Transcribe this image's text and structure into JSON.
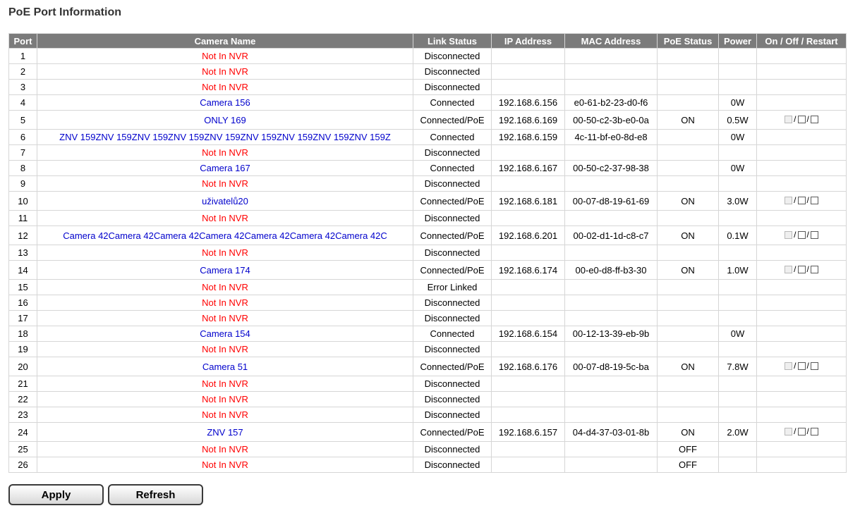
{
  "page": {
    "title": "PoE Port Information"
  },
  "table": {
    "headers": {
      "port": "Port",
      "camera_name": "Camera Name",
      "link_status": "Link Status",
      "ip": "IP Address",
      "mac": "MAC Address",
      "poe_status": "PoE Status",
      "power": "Power",
      "control": "On / Off / Restart"
    },
    "control_separator": "/",
    "rows": [
      {
        "port": "1",
        "camera": "Not In NVR",
        "cam_color": "red",
        "link": "Disconnected",
        "ip": "",
        "mac": "",
        "poe": "",
        "power": "",
        "control": false
      },
      {
        "port": "2",
        "camera": "Not In NVR",
        "cam_color": "red",
        "link": "Disconnected",
        "ip": "",
        "mac": "",
        "poe": "",
        "power": "",
        "control": false
      },
      {
        "port": "3",
        "camera": "Not In NVR",
        "cam_color": "red",
        "link": "Disconnected",
        "ip": "",
        "mac": "",
        "poe": "",
        "power": "",
        "control": false
      },
      {
        "port": "4",
        "camera": "Camera 156",
        "cam_color": "blue",
        "link": "Connected",
        "ip": "192.168.6.156",
        "mac": "e0-61-b2-23-d0-f6",
        "poe": "",
        "power": "0W",
        "control": false
      },
      {
        "port": "5",
        "camera": "ONLY 169",
        "cam_color": "blue",
        "link": "Connected/PoE",
        "ip": "192.168.6.169",
        "mac": "00-50-c2-3b-e0-0a",
        "poe": "ON",
        "power": "0.5W",
        "control": true
      },
      {
        "port": "6",
        "camera": "ZNV 159ZNV 159ZNV 159ZNV 159ZNV 159ZNV 159ZNV 159ZNV 159ZNV 159Z",
        "cam_color": "blue",
        "link": "Connected",
        "ip": "192.168.6.159",
        "mac": "4c-11-bf-e0-8d-e8",
        "poe": "",
        "power": "0W",
        "control": false
      },
      {
        "port": "7",
        "camera": "Not In NVR",
        "cam_color": "red",
        "link": "Disconnected",
        "ip": "",
        "mac": "",
        "poe": "",
        "power": "",
        "control": false
      },
      {
        "port": "8",
        "camera": "Camera 167",
        "cam_color": "blue",
        "link": "Connected",
        "ip": "192.168.6.167",
        "mac": "00-50-c2-37-98-38",
        "poe": "",
        "power": "0W",
        "control": false
      },
      {
        "port": "9",
        "camera": "Not In NVR",
        "cam_color": "red",
        "link": "Disconnected",
        "ip": "",
        "mac": "",
        "poe": "",
        "power": "",
        "control": false
      },
      {
        "port": "10",
        "camera": "uživatelů20",
        "cam_color": "blue",
        "link": "Connected/PoE",
        "ip": "192.168.6.181",
        "mac": "00-07-d8-19-61-69",
        "poe": "ON",
        "power": "3.0W",
        "control": true
      },
      {
        "port": "11",
        "camera": "Not In NVR",
        "cam_color": "red",
        "link": "Disconnected",
        "ip": "",
        "mac": "",
        "poe": "",
        "power": "",
        "control": false
      },
      {
        "port": "12",
        "camera": "Camera 42Camera 42Camera 42Camera 42Camera 42Camera 42Camera 42C",
        "cam_color": "blue",
        "link": "Connected/PoE",
        "ip": "192.168.6.201",
        "mac": "00-02-d1-1d-c8-c7",
        "poe": "ON",
        "power": "0.1W",
        "control": true
      },
      {
        "port": "13",
        "camera": "Not In NVR",
        "cam_color": "red",
        "link": "Disconnected",
        "ip": "",
        "mac": "",
        "poe": "",
        "power": "",
        "control": false
      },
      {
        "port": "14",
        "camera": "Camera 174",
        "cam_color": "blue",
        "link": "Connected/PoE",
        "ip": "192.168.6.174",
        "mac": "00-e0-d8-ff-b3-30",
        "poe": "ON",
        "power": "1.0W",
        "control": true
      },
      {
        "port": "15",
        "camera": "Not In NVR",
        "cam_color": "red",
        "link": "Error Linked",
        "ip": "",
        "mac": "",
        "poe": "",
        "power": "",
        "control": false
      },
      {
        "port": "16",
        "camera": "Not In NVR",
        "cam_color": "red",
        "link": "Disconnected",
        "ip": "",
        "mac": "",
        "poe": "",
        "power": "",
        "control": false
      },
      {
        "port": "17",
        "camera": "Not In NVR",
        "cam_color": "red",
        "link": "Disconnected",
        "ip": "",
        "mac": "",
        "poe": "",
        "power": "",
        "control": false
      },
      {
        "port": "18",
        "camera": "Camera 154",
        "cam_color": "blue",
        "link": "Connected",
        "ip": "192.168.6.154",
        "mac": "00-12-13-39-eb-9b",
        "poe": "",
        "power": "0W",
        "control": false
      },
      {
        "port": "19",
        "camera": "Not In NVR",
        "cam_color": "red",
        "link": "Disconnected",
        "ip": "",
        "mac": "",
        "poe": "",
        "power": "",
        "control": false
      },
      {
        "port": "20",
        "camera": "Camera 51",
        "cam_color": "blue",
        "link": "Connected/PoE",
        "ip": "192.168.6.176",
        "mac": "00-07-d8-19-5c-ba",
        "poe": "ON",
        "power": "7.8W",
        "control": true
      },
      {
        "port": "21",
        "camera": "Not In NVR",
        "cam_color": "red",
        "link": "Disconnected",
        "ip": "",
        "mac": "",
        "poe": "",
        "power": "",
        "control": false
      },
      {
        "port": "22",
        "camera": "Not In NVR",
        "cam_color": "red",
        "link": "Disconnected",
        "ip": "",
        "mac": "",
        "poe": "",
        "power": "",
        "control": false
      },
      {
        "port": "23",
        "camera": "Not In NVR",
        "cam_color": "red",
        "link": "Disconnected",
        "ip": "",
        "mac": "",
        "poe": "",
        "power": "",
        "control": false
      },
      {
        "port": "24",
        "camera": "ZNV 157",
        "cam_color": "blue",
        "link": "Connected/PoE",
        "ip": "192.168.6.157",
        "mac": "04-d4-37-03-01-8b",
        "poe": "ON",
        "power": "2.0W",
        "control": true
      },
      {
        "port": "25",
        "camera": "Not In NVR",
        "cam_color": "red",
        "link": "Disconnected",
        "ip": "",
        "mac": "",
        "poe": "OFF",
        "power": "",
        "control": false
      },
      {
        "port": "26",
        "camera": "Not In NVR",
        "cam_color": "red",
        "link": "Disconnected",
        "ip": "",
        "mac": "",
        "poe": "OFF",
        "power": "",
        "control": false
      }
    ]
  },
  "buttons": {
    "apply": "Apply",
    "refresh": "Refresh"
  },
  "colors": {
    "header_bg": "#7b7b7b",
    "not_in_nvr": "#ff0000",
    "camera_link": "#0000cc"
  }
}
